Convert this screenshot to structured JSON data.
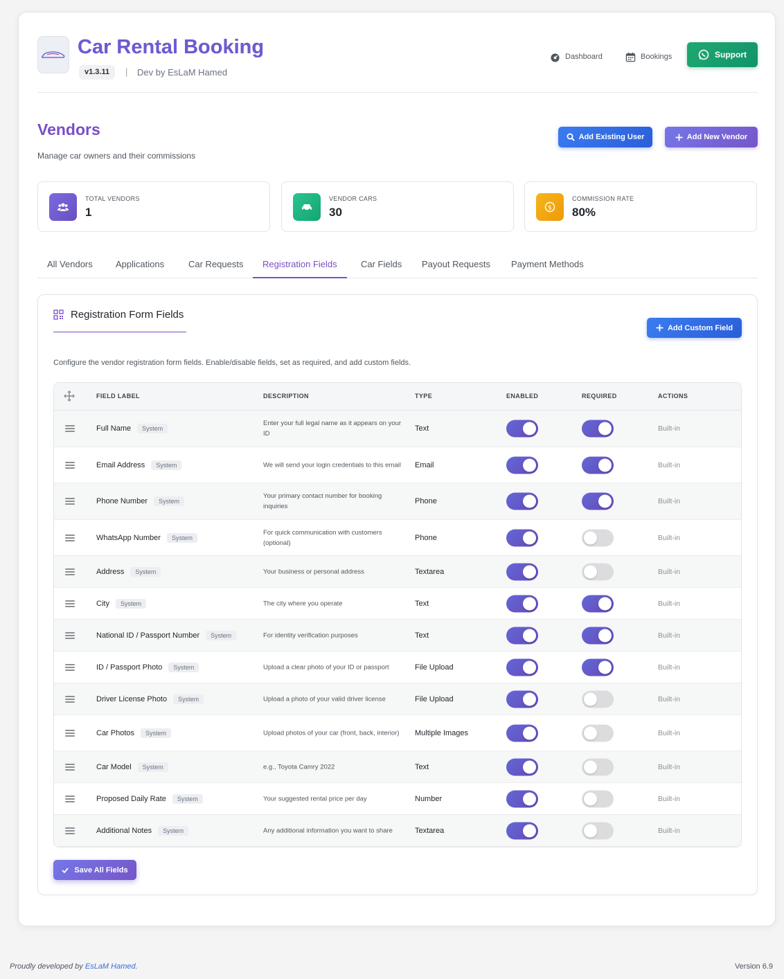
{
  "header": {
    "title": "Car Rental Booking",
    "version": "v1.3.11",
    "separator": "|",
    "dev_by": "Dev by EsLaM Hamed",
    "nav": [
      {
        "label": "Dashboard",
        "icon": "dashboard-icon"
      },
      {
        "label": "Bookings",
        "icon": "calendar-icon"
      }
    ],
    "support_label": "Support"
  },
  "page": {
    "title": "Vendors",
    "subtitle": "Manage car owners and their commissions",
    "add_existing_label": "Add Existing User",
    "add_new_label": "Add New Vendor"
  },
  "stats": [
    {
      "label": "TOTAL VENDORS",
      "value": "1",
      "icon": "users-icon",
      "color": "#6f5fd0"
    },
    {
      "label": "VENDOR CARS",
      "value": "30",
      "icon": "car-icon",
      "color": "#1fb383"
    },
    {
      "label": "COMMISSION RATE",
      "value": "80%",
      "icon": "dollar-icon",
      "color": "#f2a30f"
    }
  ],
  "tabs": [
    {
      "label": "All Vendors",
      "active": false
    },
    {
      "label": "Applications",
      "active": false
    },
    {
      "label": "Car Requests",
      "active": false
    },
    {
      "label": "Registration Fields",
      "active": true
    },
    {
      "label": "Car Fields",
      "active": false
    },
    {
      "label": "Payout Requests",
      "active": false
    },
    {
      "label": "Payment Methods",
      "active": false
    }
  ],
  "panel": {
    "title": "Registration Form Fields",
    "add_custom_label": "Add Custom Field",
    "description": "Configure the vendor registration form fields. Enable/disable fields, set as required, and add custom fields.",
    "save_label": "Save All Fields"
  },
  "table": {
    "headers": {
      "label": "FIELD LABEL",
      "description": "DESCRIPTION",
      "type": "TYPE",
      "enabled": "ENABLED",
      "required": "REQUIRED",
      "actions": "ACTIONS"
    },
    "badge": "System",
    "action_text": "Built-in",
    "rows": [
      {
        "label": "Full Name",
        "description": "Enter your full legal name as it appears on your ID",
        "type": "Text",
        "enabled": true,
        "required": true
      },
      {
        "label": "Email Address",
        "description": "We will send your login credentials to this email",
        "type": "Email",
        "enabled": true,
        "required": true
      },
      {
        "label": "Phone Number",
        "description": "Your primary contact number for booking inquiries",
        "type": "Phone",
        "enabled": true,
        "required": true
      },
      {
        "label": "WhatsApp Number",
        "description": "For quick communication with customers (optional)",
        "type": "Phone",
        "enabled": true,
        "required": false
      },
      {
        "label": "Address",
        "description": "Your business or personal address",
        "type": "Textarea",
        "enabled": true,
        "required": false
      },
      {
        "label": "City",
        "description": "The city where you operate",
        "type": "Text",
        "enabled": true,
        "required": true
      },
      {
        "label": "National ID / Passport Number",
        "description": "For identity verification purposes",
        "type": "Text",
        "enabled": true,
        "required": true
      },
      {
        "label": "ID / Passport Photo",
        "description": "Upload a clear photo of your ID or passport",
        "type": "File Upload",
        "enabled": true,
        "required": true
      },
      {
        "label": "Driver License Photo",
        "description": "Upload a photo of your valid driver license",
        "type": "File Upload",
        "enabled": true,
        "required": false
      },
      {
        "label": "Car Photos",
        "description": "Upload photos of your car (front, back, interior)",
        "type": "Multiple Images",
        "enabled": true,
        "required": false
      },
      {
        "label": "Car Model",
        "description": "e.g., Toyota Camry 2022",
        "type": "Text",
        "enabled": true,
        "required": false
      },
      {
        "label": "Proposed Daily Rate",
        "description": "Your suggested rental price per day",
        "type": "Number",
        "enabled": true,
        "required": false
      },
      {
        "label": "Additional Notes",
        "description": "Any additional information you want to share",
        "type": "Textarea",
        "enabled": true,
        "required": false
      }
    ]
  },
  "footer": {
    "prefix": "Proudly developed by ",
    "author": "EsLaM Hamed",
    "suffix": ".",
    "version": "Version 6.9"
  }
}
